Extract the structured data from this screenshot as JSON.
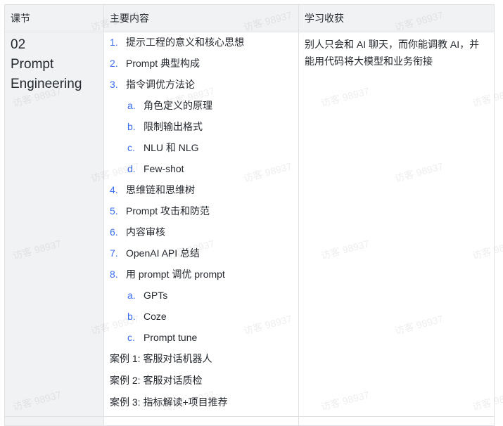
{
  "table": {
    "headers": [
      "课节",
      "主要内容",
      "学习收获"
    ],
    "lesson": {
      "number": "02",
      "title_line1": "Prompt",
      "title_line2": "Engineering"
    },
    "content": [
      {
        "marker": "1.",
        "text": "提示工程的意义和核心思想",
        "level": 1
      },
      {
        "marker": "2.",
        "text": "Prompt 典型构成",
        "level": 1
      },
      {
        "marker": "3.",
        "text": "指令调优方法论",
        "level": 1
      },
      {
        "marker": "a.",
        "text": "角色定义的原理",
        "level": 2
      },
      {
        "marker": "b.",
        "text": "限制输出格式",
        "level": 2
      },
      {
        "marker": "c.",
        "text": "NLU 和 NLG",
        "level": 2
      },
      {
        "marker": "d.",
        "text": "Few-shot",
        "level": 2
      },
      {
        "marker": "4.",
        "text": "思维链和思维树",
        "level": 1
      },
      {
        "marker": "5.",
        "text": "Prompt 攻击和防范",
        "level": 1
      },
      {
        "marker": "6.",
        "text": "内容审核",
        "level": 1
      },
      {
        "marker": "7.",
        "text": "OpenAI API 总结",
        "level": 1
      },
      {
        "marker": "8.",
        "text": "用 prompt 调优 prompt",
        "level": 1
      },
      {
        "marker": "a.",
        "text": "GPTs",
        "level": 2
      },
      {
        "marker": "b.",
        "text": "Coze",
        "level": 2
      },
      {
        "marker": "c.",
        "text": "Prompt tune",
        "level": 2
      }
    ],
    "cases": [
      "案例 1: 客服对话机器人",
      "案例 2: 客服对话质检",
      "案例 3: 指标解读+项目推荐"
    ],
    "gain": "别人只会和 AI 聊天，而你能调教 AI，并能用代码将大模型和业务衔接"
  },
  "watermark": "访客 98937",
  "colors": {
    "marker": "#3a6ff2",
    "header_bg": "#f1f2f4",
    "border": "#dfe1e4"
  }
}
